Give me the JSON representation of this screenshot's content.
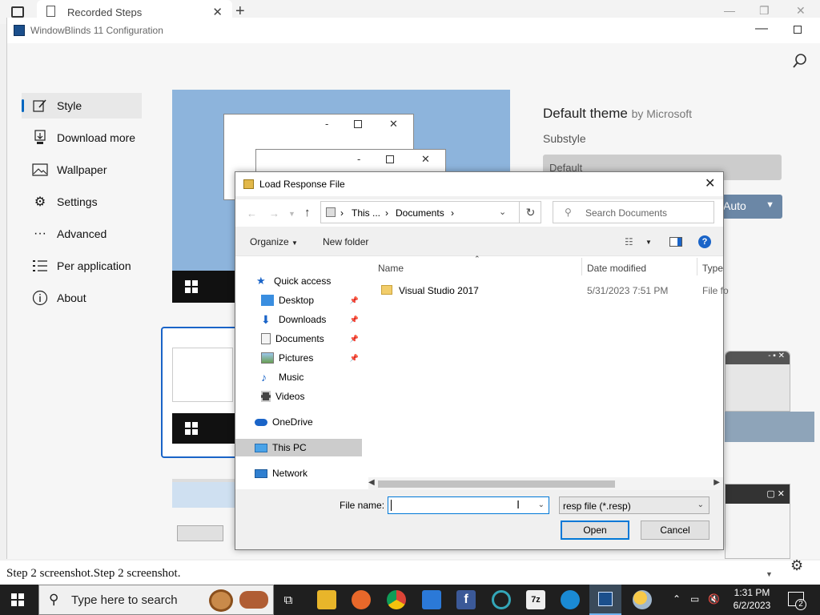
{
  "browser": {
    "tab_title": "Recorded Steps"
  },
  "wb": {
    "title": "WindowBlinds 11 Configuration",
    "nav": [
      {
        "label": "Style",
        "icon": "edit-icon"
      },
      {
        "label": "Download more",
        "icon": "download-icon"
      },
      {
        "label": "Wallpaper",
        "icon": "picture-icon"
      },
      {
        "label": "Settings",
        "icon": "gear-icon"
      },
      {
        "label": "Advanced",
        "icon": "more-icon"
      },
      {
        "label": "Per application",
        "icon": "list-icon"
      },
      {
        "label": "About",
        "icon": "info-icon"
      }
    ],
    "selected_nav": "Style",
    "theme_name": "Default theme",
    "theme_by": "by Microsoft",
    "substyle_label": "Substyle",
    "substyle_value": "Default",
    "auto_label": "Auto"
  },
  "dialog": {
    "title": "Load Response File",
    "address": [
      "This ...",
      "Documents"
    ],
    "search_placeholder": "Search Documents",
    "organize_label": "Organize",
    "new_folder_label": "New folder",
    "help_label": "?",
    "tree": [
      {
        "label": "Quick access",
        "icon": "star-icon",
        "level": 0,
        "pinned": false
      },
      {
        "label": "Desktop",
        "icon": "desktop-icon",
        "level": 1,
        "pinned": true
      },
      {
        "label": "Downloads",
        "icon": "download-icon",
        "level": 1,
        "pinned": true
      },
      {
        "label": "Documents",
        "icon": "documents-icon",
        "level": 1,
        "pinned": true
      },
      {
        "label": "Pictures",
        "icon": "pictures-icon",
        "level": 1,
        "pinned": true
      },
      {
        "label": "Music",
        "icon": "music-icon",
        "level": 1,
        "pinned": false
      },
      {
        "label": "Videos",
        "icon": "video-icon",
        "level": 1,
        "pinned": false
      },
      {
        "label": "OneDrive",
        "icon": "cloud-icon",
        "level": 0,
        "pinned": false
      },
      {
        "label": "This PC",
        "icon": "computer-icon",
        "level": 0,
        "pinned": false,
        "selected": true
      },
      {
        "label": "Network",
        "icon": "network-icon",
        "level": 0,
        "pinned": false
      }
    ],
    "columns": [
      "Name",
      "Date modified",
      "Type"
    ],
    "files": [
      {
        "name": "Visual Studio 2017",
        "date": "5/31/2023 7:51 PM",
        "type": "File fo"
      }
    ],
    "file_name_label": "File name:",
    "file_name_value": "",
    "file_type": "resp file (*.resp)",
    "open_label": "Open",
    "cancel_label": "Cancel"
  },
  "footer": {
    "text": "Step 2 screenshot.Step 2 screenshot."
  },
  "taskbar": {
    "search_placeholder": "Type here to search",
    "time": "1:31 PM",
    "date": "6/2/2023",
    "notification_count": "2",
    "apps": [
      "task-view-icon",
      "file-explorer-icon",
      "firefox-icon",
      "chrome-icon",
      "store-icon",
      "facebook-icon",
      "opera-icon",
      "7zip-icon",
      "edge-icon",
      "windowblinds-icon",
      "weather-icon"
    ]
  }
}
